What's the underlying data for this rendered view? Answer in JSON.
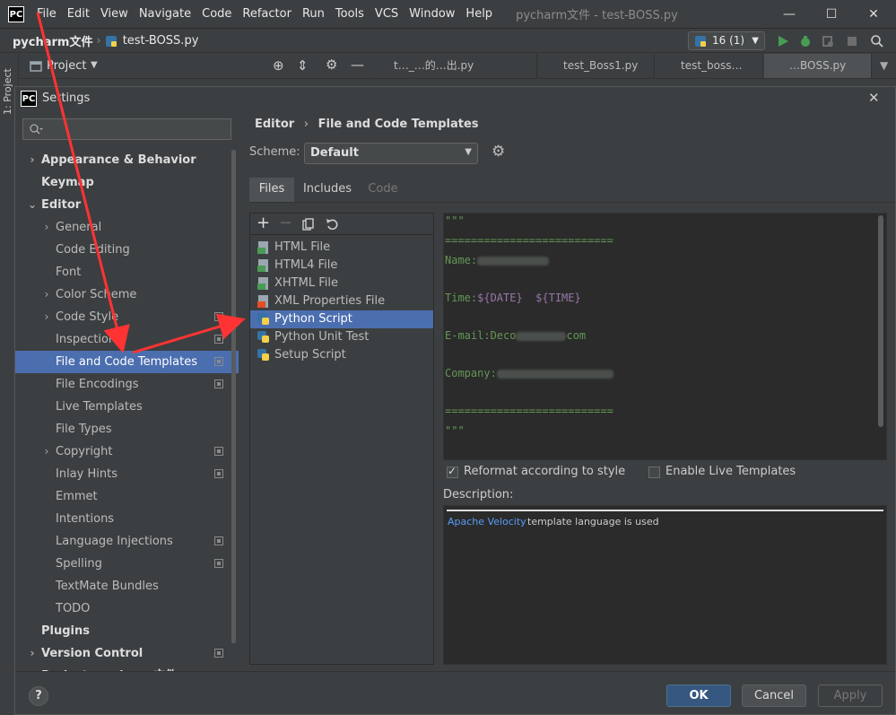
{
  "ide": {
    "logo": "PC",
    "menu": [
      "File",
      "Edit",
      "View",
      "Navigate",
      "Code",
      "Refactor",
      "Run",
      "Tools",
      "VCS",
      "Window",
      "Help"
    ],
    "window_title": "pycharm文件 - test-BOSS.py",
    "breadcrumb_project": "pycharm文件",
    "breadcrumb_file": "test-BOSS.py",
    "run_config": "16 (1)",
    "project_tool_label": "Project",
    "left_strip_label": "1: Project",
    "editor_tabs": [
      "t…_…的…出.py",
      "test_Boss1.py",
      "test_boss…",
      "…BOSS.py"
    ]
  },
  "dialog": {
    "title": "Settings",
    "breadcrumb_parent": "Editor",
    "breadcrumb_sep": "›",
    "breadcrumb_current": "File and Code Templates",
    "scheme_label": "Scheme:",
    "scheme_value": "Default",
    "tabs": [
      "Files",
      "Includes",
      "Code"
    ],
    "sidebar": [
      {
        "label": "Appearance & Behavior",
        "level": 0,
        "expander": "›",
        "bold": true
      },
      {
        "label": "Keymap",
        "level": 0,
        "bold": true
      },
      {
        "label": "Editor",
        "level": 0,
        "expander": "⌄",
        "bold": true
      },
      {
        "label": "General",
        "level": 1,
        "expander": "›"
      },
      {
        "label": "Code Editing",
        "level": 1
      },
      {
        "label": "Font",
        "level": 1
      },
      {
        "label": "Color Scheme",
        "level": 1,
        "expander": "›"
      },
      {
        "label": "Code Style",
        "level": 1,
        "expander": "›",
        "project": true
      },
      {
        "label": "Inspections",
        "level": 1,
        "project": true
      },
      {
        "label": "File and Code Templates",
        "level": 1,
        "project": true,
        "selected": true
      },
      {
        "label": "File Encodings",
        "level": 1,
        "project": true
      },
      {
        "label": "Live Templates",
        "level": 1
      },
      {
        "label": "File Types",
        "level": 1
      },
      {
        "label": "Copyright",
        "level": 1,
        "expander": "›",
        "project": true
      },
      {
        "label": "Inlay Hints",
        "level": 1,
        "project": true
      },
      {
        "label": "Emmet",
        "level": 1
      },
      {
        "label": "Intentions",
        "level": 1
      },
      {
        "label": "Language Injections",
        "level": 1,
        "project": true
      },
      {
        "label": "Spelling",
        "level": 1,
        "project": true
      },
      {
        "label": "TextMate Bundles",
        "level": 1
      },
      {
        "label": "TODO",
        "level": 1
      },
      {
        "label": "Plugins",
        "level": 0,
        "bold": true
      },
      {
        "label": "Version Control",
        "level": 0,
        "expander": "›",
        "bold": true,
        "project": true
      },
      {
        "label": "Project: pycharm文件",
        "level": 0,
        "expander": "›",
        "bold": true,
        "project": true
      }
    ],
    "templates": [
      {
        "name": "HTML File",
        "icon": "html-icon",
        "color": "#e44d26"
      },
      {
        "name": "HTML4 File",
        "icon": "html4-icon",
        "color": "#e44d26"
      },
      {
        "name": "XHTML File",
        "icon": "xhtml-icon",
        "color": "#e44d26"
      },
      {
        "name": "XML Properties File",
        "icon": "xml-properties-icon",
        "color": "#e44d26"
      },
      {
        "name": "Python Script",
        "icon": "python-icon",
        "color": "#3572a5",
        "selected": true
      },
      {
        "name": "Python Unit Test",
        "icon": "python-icon",
        "color": "#3572a5"
      },
      {
        "name": "Setup Script",
        "icon": "python-icon",
        "color": "#3572a5"
      }
    ],
    "template_lines": {
      "quote_open": "\"\"\"",
      "rule_top": "==========================",
      "name_label": "Name:",
      "time_label": "Time:",
      "date_var": "${DATE}",
      "time_var": "${TIME}",
      "email_label": "E-mail:",
      "email_visible_start": "Deco",
      "email_visible_end": "com",
      "company_label": "Company:",
      "rule_bottom": "==========================",
      "quote_close": "\"\"\""
    },
    "reformat_label": "Reformat according to style",
    "reformat_checked": true,
    "live_templates_label": "Enable Live Templates",
    "live_templates_checked": false,
    "description_label": "Description:",
    "description_link": "Apache Velocity",
    "description_text": "template language is used",
    "buttons": {
      "ok": "OK",
      "cancel": "Cancel",
      "apply": "Apply"
    },
    "help": "?"
  },
  "colors": {
    "accent_selection": "#4b6eaf",
    "ok_button": "#365880",
    "annotation_arrow": "#ff3333"
  }
}
